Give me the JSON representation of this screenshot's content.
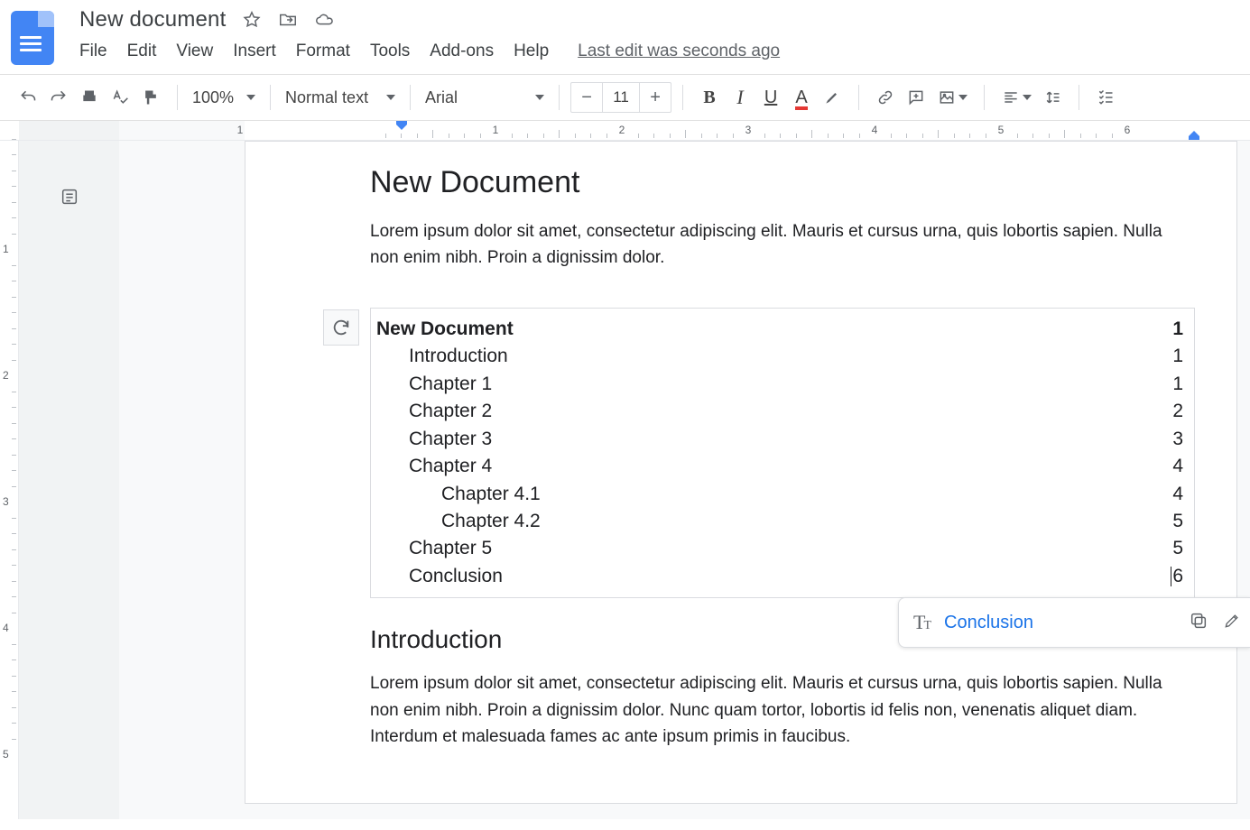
{
  "header": {
    "title": "New document",
    "last_edit": "Last edit was seconds ago"
  },
  "menu": {
    "file": "File",
    "edit": "Edit",
    "view": "View",
    "insert": "Insert",
    "format": "Format",
    "tools": "Tools",
    "addons": "Add-ons",
    "help": "Help"
  },
  "toolbar": {
    "zoom": "100%",
    "style": "Normal text",
    "font": "Arial",
    "font_size": "11"
  },
  "ruler": {
    "h_numbers": [
      "1",
      "1",
      "2",
      "3",
      "4",
      "5",
      "6"
    ],
    "v_numbers": [
      "1",
      "2",
      "3",
      "4",
      "5"
    ]
  },
  "document": {
    "title": "New Document",
    "intro_para": "Lorem ipsum dolor sit amet, consectetur adipiscing elit. Mauris et cursus urna, quis lobortis sapien. Nulla non enim nibh. Proin a dignissim dolor.",
    "toc": [
      {
        "level": 0,
        "label": "New Document",
        "page": "1"
      },
      {
        "level": 1,
        "label": "Introduction",
        "page": "1"
      },
      {
        "level": 1,
        "label": "Chapter 1",
        "page": "1"
      },
      {
        "level": 1,
        "label": "Chapter 2",
        "page": "2"
      },
      {
        "level": 1,
        "label": "Chapter 3",
        "page": "3"
      },
      {
        "level": 1,
        "label": "Chapter 4",
        "page": "4"
      },
      {
        "level": 2,
        "label": "Chapter 4.1",
        "page": "4"
      },
      {
        "level": 2,
        "label": "Chapter 4.2",
        "page": "5"
      },
      {
        "level": 1,
        "label": "Chapter 5",
        "page": "5"
      },
      {
        "level": 1,
        "label": "Conclusion",
        "page": "6"
      }
    ],
    "h2_intro": "Introduction",
    "body_para": "Lorem ipsum dolor sit amet, consectetur adipiscing elit. Mauris et cursus urna, quis lobortis sapien. Nulla non enim nibh. Proin a dignissim dolor. Nunc quam tortor, lobortis id felis non, venenatis aliquet diam. Interdum et malesuada fames ac ante ipsum primis in faucibus."
  },
  "chip": {
    "link_text": "Conclusion"
  }
}
